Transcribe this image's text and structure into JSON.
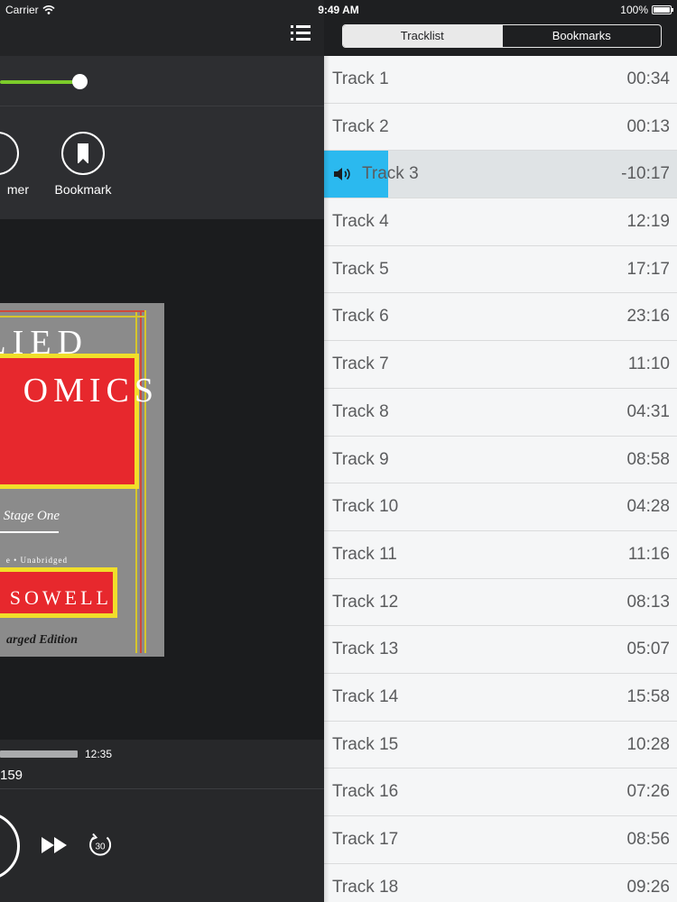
{
  "status_bar": {
    "carrier": "Carrier",
    "time": "9:49 AM",
    "battery": "100%"
  },
  "player": {
    "progress_fraction": 0.25,
    "actions": {
      "timer_label": "mer",
      "bookmark_label": "Bookmark"
    },
    "cover": {
      "title_line1": "LIED",
      "title_line2": "OMICS",
      "subtitle": "l Stage One",
      "format": "e • Unabridged",
      "author": "SOWELL",
      "edition": "arged Edition"
    },
    "time_total": "12:35",
    "chapter_number": "159",
    "skip_label": "30"
  },
  "tracklist_panel": {
    "tabs": [
      {
        "label": "Tracklist",
        "active": true
      },
      {
        "label": "Bookmarks",
        "active": false
      }
    ],
    "tracks": [
      {
        "name": "Track 1",
        "duration": "00:34"
      },
      {
        "name": "Track 2",
        "duration": "00:13"
      },
      {
        "name": "Track 3",
        "duration": "-10:17",
        "playing": true
      },
      {
        "name": "Track 4",
        "duration": "12:19"
      },
      {
        "name": "Track 5",
        "duration": "17:17"
      },
      {
        "name": "Track 6",
        "duration": "23:16"
      },
      {
        "name": "Track 7",
        "duration": "11:10"
      },
      {
        "name": "Track 8",
        "duration": "04:31"
      },
      {
        "name": "Track 9",
        "duration": "08:58"
      },
      {
        "name": "Track 10",
        "duration": "04:28"
      },
      {
        "name": "Track 11",
        "duration": "11:16"
      },
      {
        "name": "Track 12",
        "duration": "08:13"
      },
      {
        "name": "Track 13",
        "duration": "05:07"
      },
      {
        "name": "Track 14",
        "duration": "15:58"
      },
      {
        "name": "Track 15",
        "duration": "10:28"
      },
      {
        "name": "Track 16",
        "duration": "07:26"
      },
      {
        "name": "Track 17",
        "duration": "08:56"
      },
      {
        "name": "Track 18",
        "duration": "09:26"
      }
    ]
  },
  "colors": {
    "progress_accent": "#7ccc2a",
    "playing_highlight": "#2bb9ef",
    "cover_red": "#e7282d",
    "cover_yellow": "#f1de2a"
  },
  "icons": {
    "menu": "list-icon",
    "bookmark": "bookmark-icon",
    "speaker": "speaker-icon",
    "fast_forward": "fast-forward-icon",
    "skip_forward": "skip-forward-30-icon"
  }
}
